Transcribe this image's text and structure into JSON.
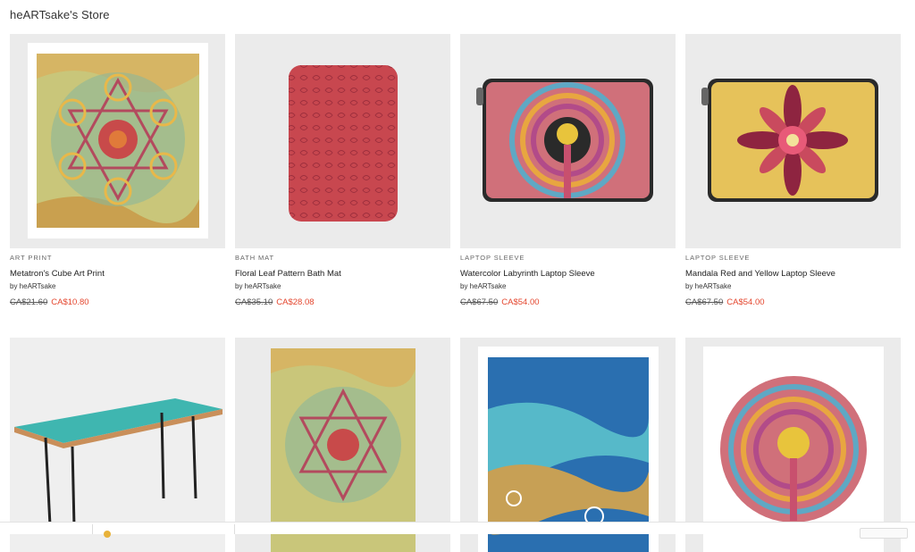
{
  "store": {
    "title": "heARTsake's Store"
  },
  "products": [
    {
      "category": "ART PRINT",
      "name": "Metatron's Cube Art Print",
      "by": "by heARTsake",
      "old_price": "CA$21.60",
      "new_price": "CA$10.80"
    },
    {
      "category": "BATH MAT",
      "name": "Floral Leaf Pattern Bath Mat",
      "by": "by heARTsake",
      "old_price": "CA$35.10",
      "new_price": "CA$28.08"
    },
    {
      "category": "LAPTOP SLEEVE",
      "name": "Watercolor Labyrinth Laptop Sleeve",
      "by": "by heARTsake",
      "old_price": "CA$67.50",
      "new_price": "CA$54.00"
    },
    {
      "category": "LAPTOP SLEEVE",
      "name": "Mandala Red and Yellow Laptop Sleeve",
      "by": "by heARTsake",
      "old_price": "CA$67.50",
      "new_price": "CA$54.00"
    }
  ],
  "colors": {
    "sale_price": "#e4462e",
    "thumb_bg": "#ebebeb"
  }
}
